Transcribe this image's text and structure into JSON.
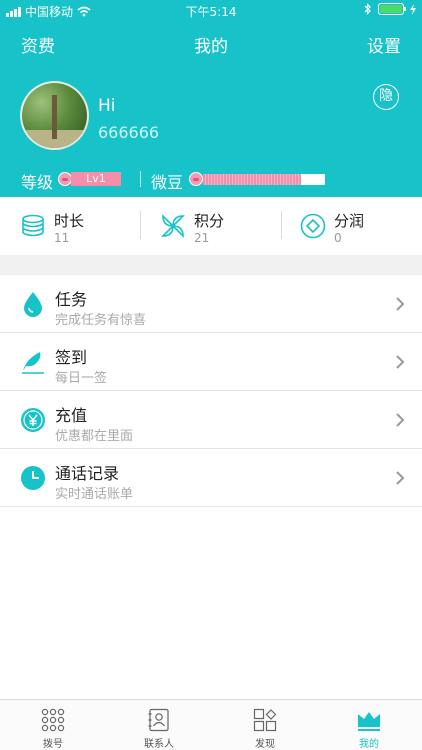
{
  "status_bar": {
    "carrier": "中国移动",
    "time": "下午5:14"
  },
  "nav": {
    "left": "资费",
    "title": "我的",
    "right": "设置"
  },
  "profile": {
    "greeting": "Hi",
    "user_id": "666666",
    "hide_label": "隐"
  },
  "level": {
    "label": "等级",
    "badge": "Lv1",
    "bean_label": "微豆",
    "bean_progress": 0.8
  },
  "stats": [
    {
      "label": "时长",
      "value": "11",
      "icon": "database-icon"
    },
    {
      "label": "积分",
      "value": "21",
      "icon": "pinwheel-icon"
    },
    {
      "label": "分润",
      "value": "0",
      "icon": "diamond-icon"
    }
  ],
  "menu": [
    {
      "title": "任务",
      "subtitle": "完成任务有惊喜",
      "icon": "drop-icon"
    },
    {
      "title": "签到",
      "subtitle": "每日一签",
      "icon": "feather-icon"
    },
    {
      "title": "充值",
      "subtitle": "优惠都在里面",
      "icon": "yen-icon"
    },
    {
      "title": "通话记录",
      "subtitle": "实时通话账单",
      "icon": "clock-icon"
    }
  ],
  "tabs": [
    {
      "label": "拨号",
      "icon": "dialpad-icon"
    },
    {
      "label": "联系人",
      "icon": "contacts-icon"
    },
    {
      "label": "发现",
      "icon": "discover-icon"
    },
    {
      "label": "我的",
      "icon": "crown-icon",
      "active": true
    }
  ],
  "colors": {
    "accent": "#17c3c9",
    "pink": "#f48eab",
    "battery": "#4cd964"
  }
}
